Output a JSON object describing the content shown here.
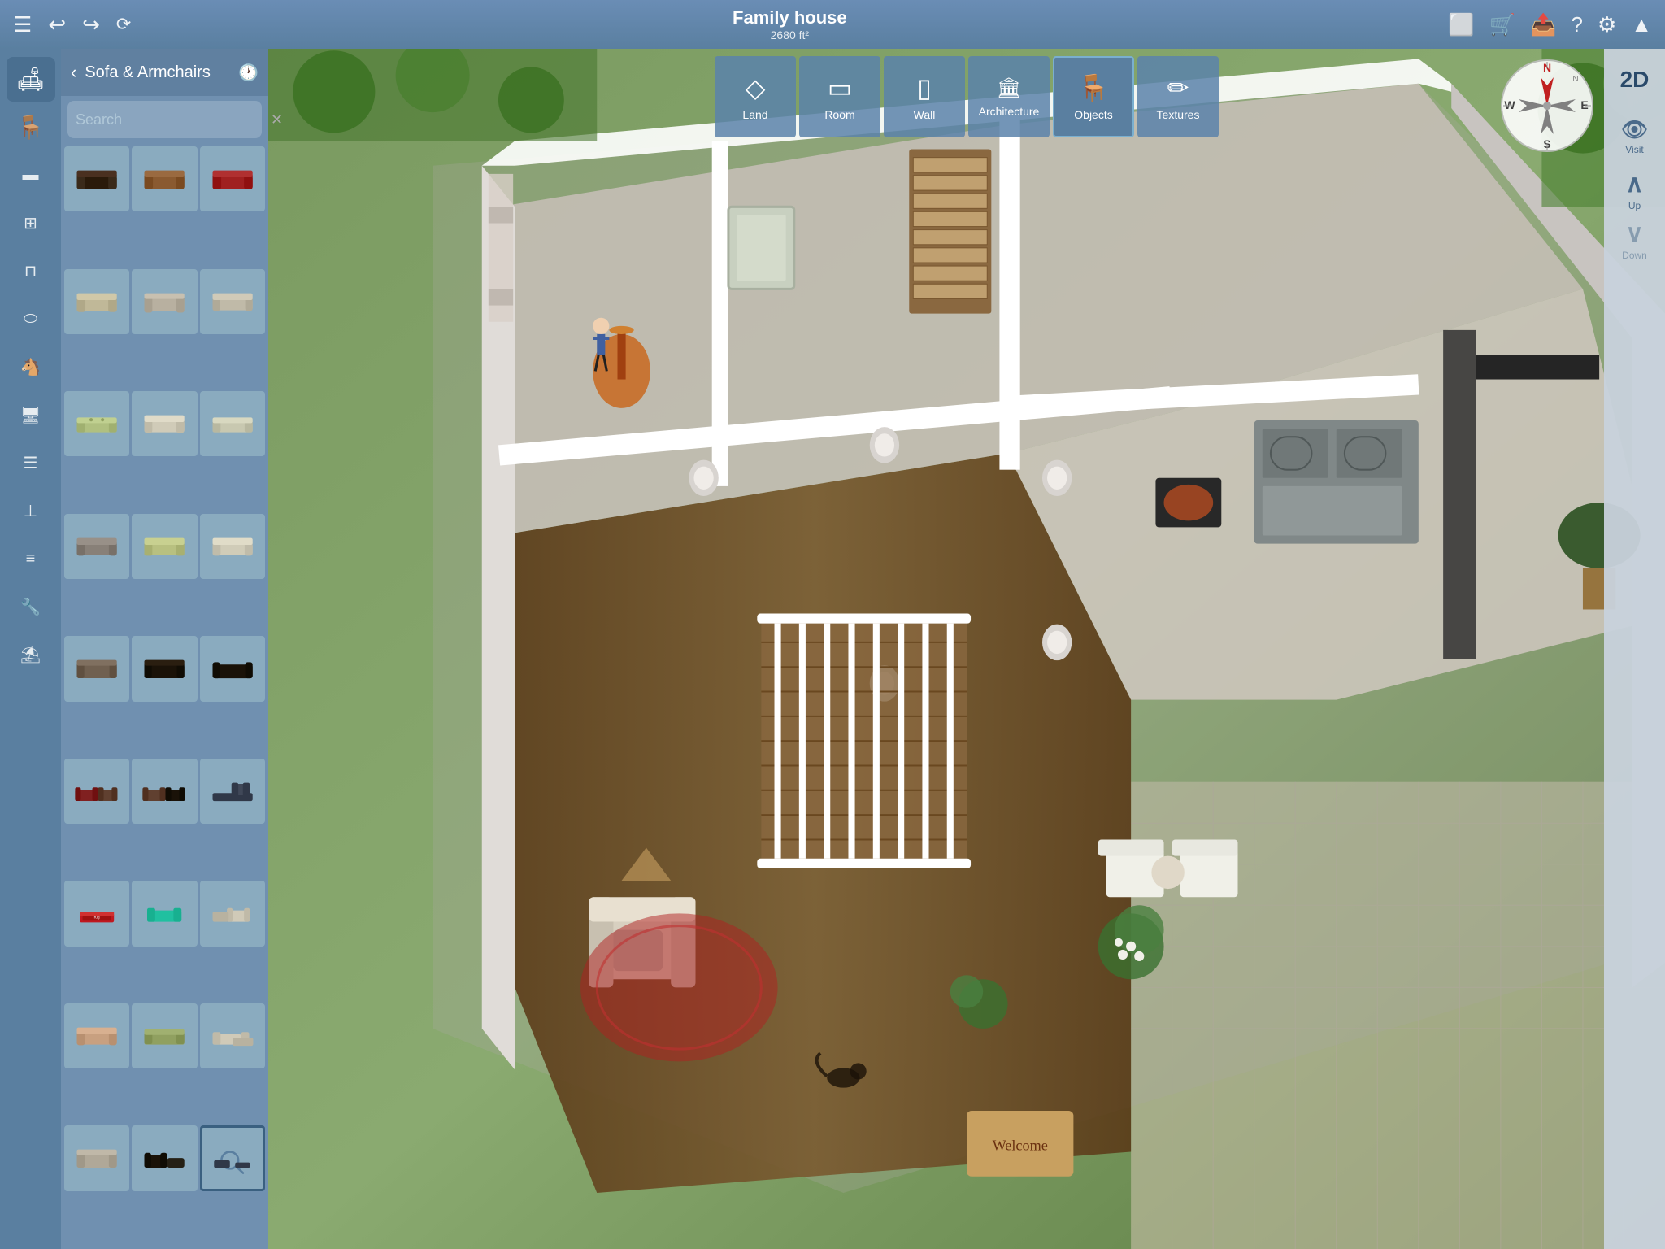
{
  "app": {
    "title": "Family house",
    "subtitle": "2680 ft²"
  },
  "topbar": {
    "menu_icon": "☰",
    "undo_icon": "↩",
    "redo_icon": "↪",
    "save_icon": "💾",
    "cart_icon": "🛒",
    "share_icon": "📤",
    "help_icon": "?",
    "settings_icon": "⚙",
    "upload_icon": "▲"
  },
  "sidebar": {
    "items": [
      {
        "id": "sofa",
        "icon": "🛋",
        "active": true
      },
      {
        "id": "chair",
        "icon": "🪑",
        "active": false
      },
      {
        "id": "table",
        "icon": "🪞",
        "active": false
      },
      {
        "id": "kitchen",
        "icon": "🍳",
        "active": false
      },
      {
        "id": "bath",
        "icon": "🛁",
        "active": false
      },
      {
        "id": "bed",
        "icon": "🛏",
        "active": false
      },
      {
        "id": "kids",
        "icon": "🪀",
        "active": false
      },
      {
        "id": "office",
        "icon": "🖥",
        "active": false
      },
      {
        "id": "curtains",
        "icon": "🪟",
        "active": false
      },
      {
        "id": "lamp",
        "icon": "💡",
        "active": false
      },
      {
        "id": "radiator",
        "icon": "♨",
        "active": false
      },
      {
        "id": "tools",
        "icon": "🔧",
        "active": false
      },
      {
        "id": "outdoor",
        "icon": "⛱",
        "active": false
      }
    ]
  },
  "panel": {
    "title": "Sofa & Armchairs",
    "back_label": "‹",
    "history_icon": "🕐",
    "search_placeholder": "Search",
    "items": [
      {
        "id": 1,
        "color": "#4a3020"
      },
      {
        "id": 2,
        "color": "#8a5a30"
      },
      {
        "id": 3,
        "color": "#b03030"
      },
      {
        "id": 4,
        "color": "#d0c8b0"
      },
      {
        "id": 5,
        "color": "#c0baa0"
      },
      {
        "id": 6,
        "color": "#c8c0a8"
      },
      {
        "id": 7,
        "color": "#c0c890"
      },
      {
        "id": 8,
        "color": "#d8d0b8"
      },
      {
        "id": 9,
        "color": "#c8c8b8"
      },
      {
        "id": 10,
        "color": "#888880"
      },
      {
        "id": 11,
        "color": "#c0c890"
      },
      {
        "id": 12,
        "color": "#d0ccb8"
      },
      {
        "id": 13,
        "color": "#786860"
      },
      {
        "id": 14,
        "color": "#302820"
      },
      {
        "id": 15,
        "color": "#282018"
      },
      {
        "id": 16,
        "color": "#802020"
      },
      {
        "id": 17,
        "color": "#604030"
      },
      {
        "id": 18,
        "color": "#302010"
      },
      {
        "id": 19,
        "color": "#e8e0d0"
      },
      {
        "id": 20,
        "color": "#30c0a0"
      },
      {
        "id": 21,
        "color": "#d0caba"
      },
      {
        "id": 22,
        "color": "#c8c0a0"
      },
      {
        "id": 23,
        "color": "#b0c080"
      },
      {
        "id": 24,
        "color": "#e0d8c8"
      },
      {
        "id": 25,
        "color": "#c8a080"
      },
      {
        "id": 26,
        "color": "#201810"
      },
      {
        "id": 27,
        "color": "#302820"
      },
      {
        "id": 28,
        "color": "#404860"
      }
    ]
  },
  "toolbar": {
    "tools": [
      {
        "id": "land",
        "label": "Land",
        "icon": "◇"
      },
      {
        "id": "room",
        "label": "Room",
        "icon": "▭"
      },
      {
        "id": "wall",
        "label": "Wall",
        "icon": "▯"
      },
      {
        "id": "architecture",
        "label": "Architecture",
        "icon": "🏛"
      },
      {
        "id": "objects",
        "label": "Objects",
        "icon": "🪑",
        "active": true
      },
      {
        "id": "textures",
        "label": "Textures",
        "icon": "✏"
      }
    ]
  },
  "right_panel": {
    "view_2d": "2D",
    "visit_label": "Visit",
    "up_label": "Up",
    "down_label": "Down"
  },
  "compass": {
    "n_label": "N",
    "s_label": "S",
    "e_label": "E",
    "w_label": "W"
  }
}
